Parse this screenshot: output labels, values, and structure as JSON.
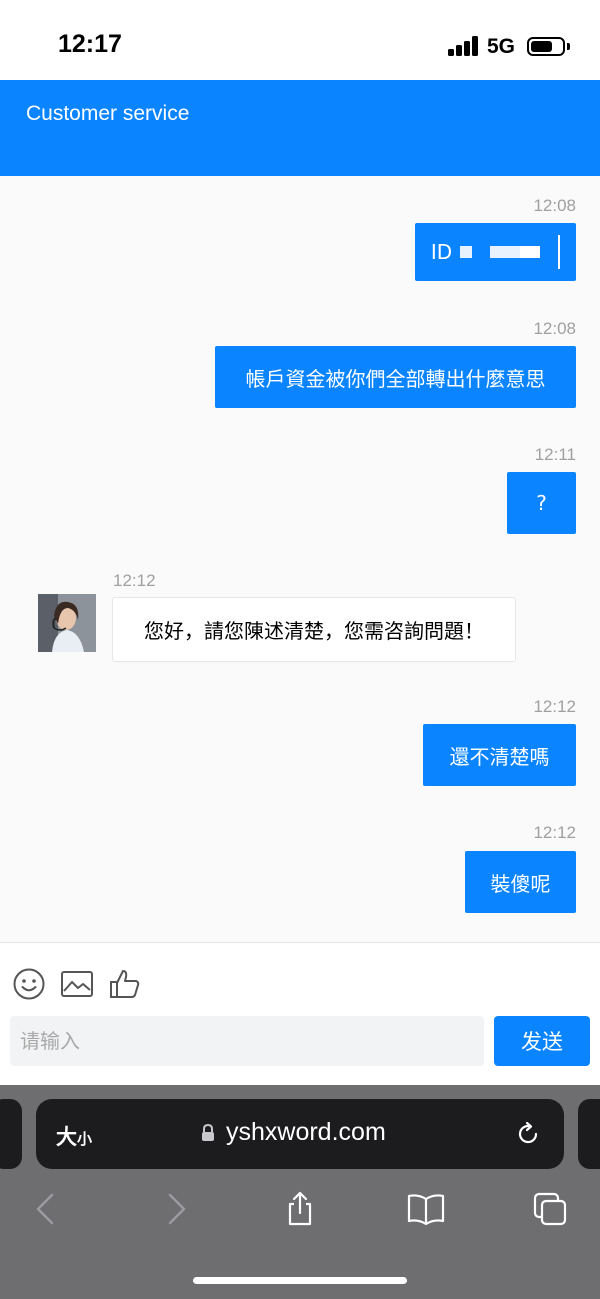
{
  "status_bar": {
    "time": "12:17",
    "network": "5G"
  },
  "header": {
    "title": "Customer service"
  },
  "messages": [
    {
      "time": "12:08",
      "text": "ID",
      "direction": "outgoing"
    },
    {
      "time": "12:08",
      "text": "帳戶資金被你們全部轉出什麼意思",
      "direction": "outgoing"
    },
    {
      "time": "12:11",
      "text": "?",
      "direction": "outgoing"
    },
    {
      "time": "12:12",
      "text": "您好，請您陳述清楚，您需咨詢問題！",
      "direction": "incoming"
    },
    {
      "time": "12:12",
      "text": "還不清楚嗎",
      "direction": "outgoing"
    },
    {
      "time": "12:12",
      "text": "裝傻呢",
      "direction": "outgoing"
    }
  ],
  "composer": {
    "icons": [
      "emoji-icon",
      "image-icon",
      "thumbs-up-icon"
    ],
    "placeholder": "请输入",
    "send_label": "发送"
  },
  "browser": {
    "text_size_label": "大",
    "text_size_small": "小",
    "url": "yshxword.com",
    "icons": [
      "lock-icon",
      "reload-icon",
      "back-icon",
      "forward-icon",
      "share-icon",
      "bookmarks-icon",
      "tabs-icon"
    ]
  },
  "colors": {
    "accent": "#0a84ff",
    "chat_background": "#fafafa",
    "browser_bar": "#1c1c1e",
    "browser_toolbar": "#6e6e71"
  }
}
